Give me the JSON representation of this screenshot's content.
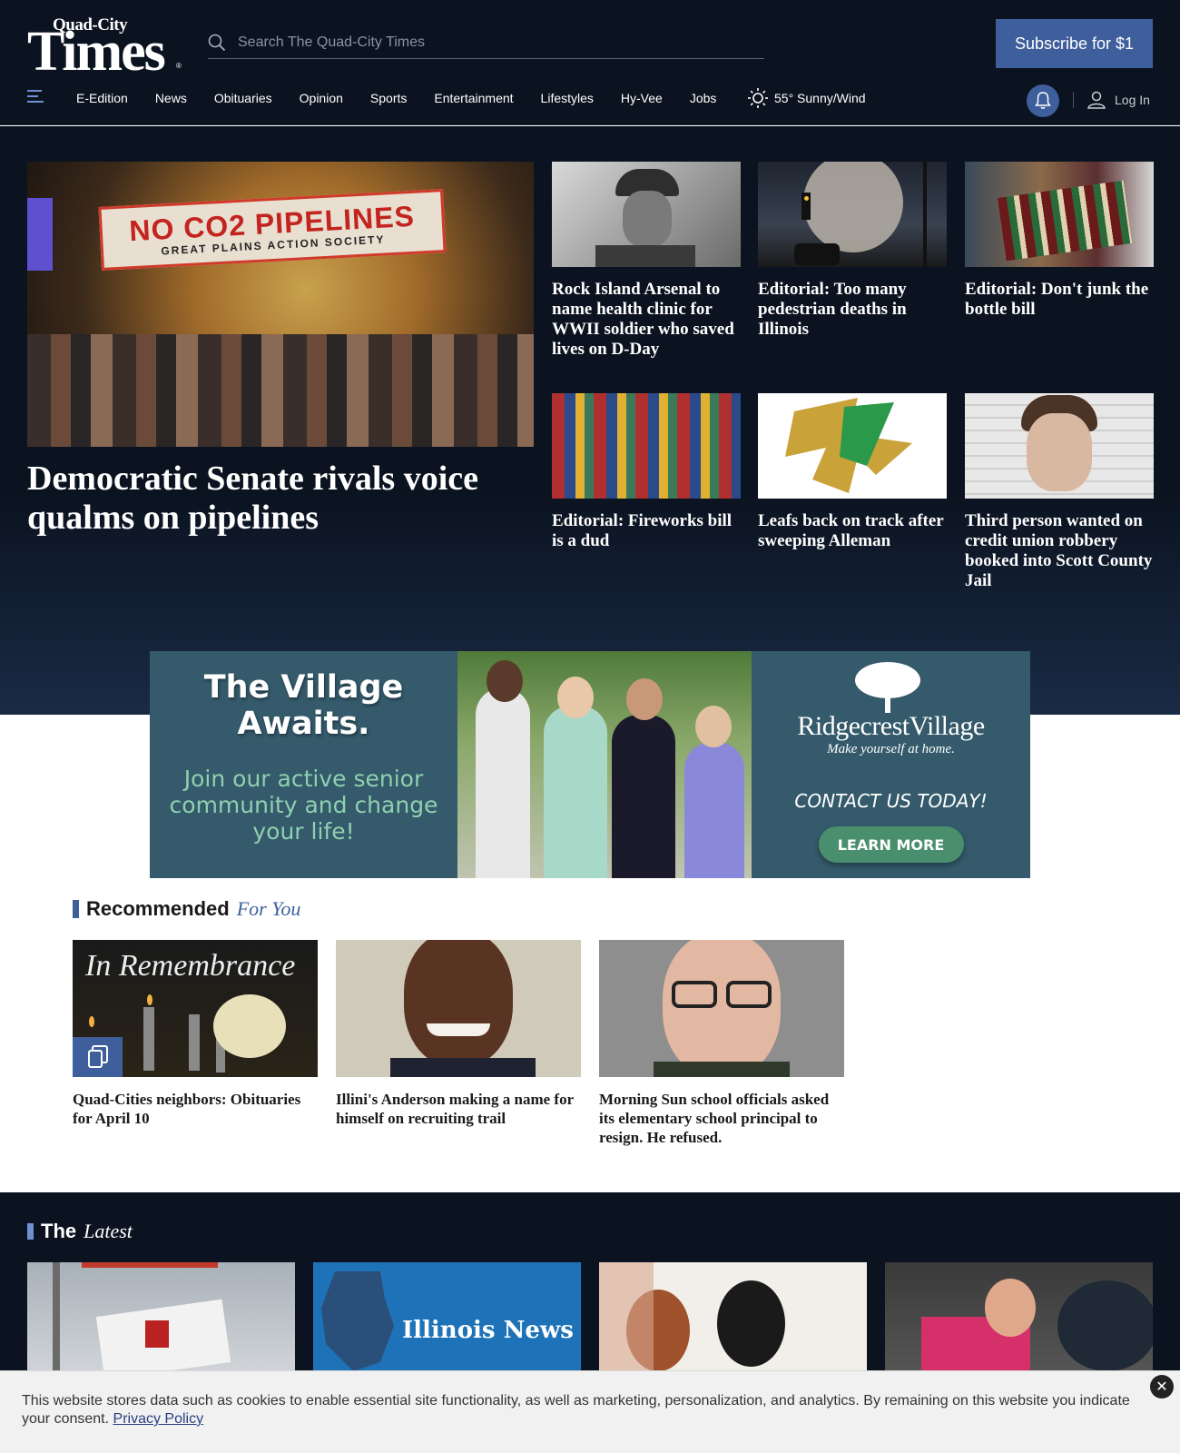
{
  "header": {
    "logo_small": "Quad-City",
    "logo_big": "Times",
    "logo_reg": "®",
    "search_placeholder": "Search The Quad-City Times",
    "subscribe_label": "Subscribe for $1"
  },
  "nav": {
    "items": [
      "E-Edition",
      "News",
      "Obituaries",
      "Opinion",
      "Sports",
      "Entertainment",
      "Lifestyles",
      "Hy-Vee",
      "Jobs"
    ],
    "weather": "55° Sunny/Wind",
    "login_label": "Log In"
  },
  "lead": {
    "banner_line1": "NO CO2 PIPELINES",
    "banner_line2": "GREAT PLAINS ACTION SOCIETY",
    "title": "Democratic Senate rivals voice qualms on pipelines"
  },
  "stories": [
    {
      "title": "Rock Island Arsenal to name health clinic for WWII soldier who saved lives on D-Day"
    },
    {
      "title": "Editorial: Too many pedestrian deaths in Illinois"
    },
    {
      "title": "Editorial: Don't junk the bottle bill"
    },
    {
      "title": "Editorial: Fireworks bill is a dud"
    },
    {
      "title": "Leafs back on track after sweeping Alleman"
    },
    {
      "title": "Third person wanted on credit union robbery booked into Scott County Jail"
    }
  ],
  "ad": {
    "headline": "The Village Awaits.",
    "subtext": "Join our active senior community and change your life!",
    "brand": "RidgecrestVillage",
    "tagline": "Make yourself at home.",
    "contact": "CONTACT US TODAY!",
    "button": "LEARN MORE"
  },
  "recommended": {
    "heading_a": "Recommended",
    "heading_b": "For You",
    "remembrance_text": "In Remembrance",
    "items": [
      {
        "title": "Quad-Cities neighbors: Obituaries for April 10"
      },
      {
        "title": "Illini's Anderson making a name for himself on recruiting trail"
      },
      {
        "title": "Morning Sun school officials asked its elementary school principal to resign. He refused."
      }
    ]
  },
  "latest": {
    "heading_a": "The",
    "heading_b": "Latest",
    "illinois_news_label": "Illinois News"
  },
  "cookie": {
    "text": "This website stores data such as cookies to enable essential site functionality, as well as marketing, personalization, and analytics. By remaining on this website you indicate your consent.",
    "link": "Privacy Policy",
    "close": "✕"
  },
  "colors": {
    "header_bg": "#0b1320",
    "accent": "#3e5f9c",
    "ad_bg": "#345a6b",
    "ad_green": "#4a8f6d"
  }
}
